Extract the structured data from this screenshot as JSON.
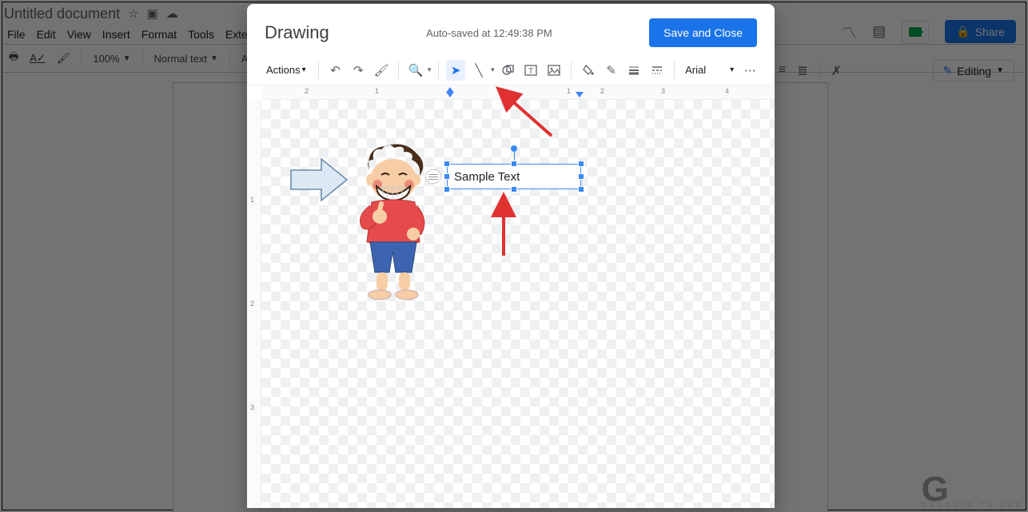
{
  "docs": {
    "title": "Untitled document",
    "menubar": [
      "File",
      "Edit",
      "View",
      "Insert",
      "Format",
      "Tools",
      "Extens"
    ],
    "toolbar": {
      "zoom": "100%",
      "style": "Normal text",
      "font": "Arial"
    },
    "share_label": "Share",
    "editing_label": "Editing"
  },
  "dialog": {
    "title": "Drawing",
    "autosave": "Auto-saved at 12:49:38 PM",
    "save_close_label": "Save and Close",
    "actions_label": "Actions",
    "font": "Arial"
  },
  "canvas": {
    "textbox_value": "Sample Text"
  },
  "ruler": {
    "h_marks": [
      {
        "pos": 54,
        "label": "2"
      },
      {
        "pos": 142,
        "label": "1"
      },
      {
        "pos": 382,
        "label": "1"
      },
      {
        "pos": 424,
        "label": "2"
      },
      {
        "pos": 500,
        "label": "3"
      },
      {
        "pos": 580,
        "label": "4"
      }
    ],
    "v_marks": [
      {
        "pos": 120,
        "label": "1"
      },
      {
        "pos": 250,
        "label": "2"
      },
      {
        "pos": 380,
        "label": "3"
      }
    ]
  },
  "watermark": {
    "brand_letter": "G",
    "brand_text": "GADGETS TO USE"
  }
}
